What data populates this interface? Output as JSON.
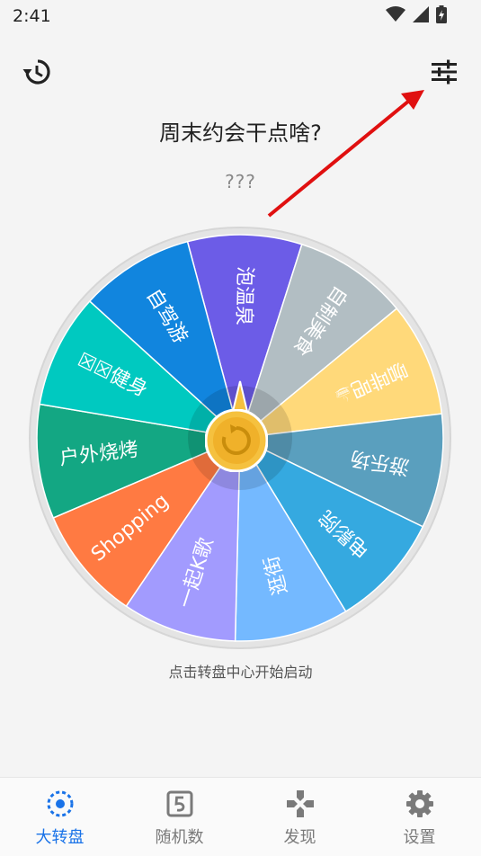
{
  "status_bar": {
    "time": "2:41",
    "icons": [
      "wifi-icon",
      "signal-icon",
      "battery-charging-icon"
    ]
  },
  "toolbar": {
    "history_icon": "history-icon",
    "settings_icon": "tune-sliders-icon"
  },
  "wheel": {
    "title": "周末约会干点啥?",
    "result": "???",
    "hint": "点击转盘中心开始启动",
    "segments": [
      {
        "label": "泡温泉",
        "color": "#6c5ce7"
      },
      {
        "label": "自制美食",
        "color": "#b2bec3"
      },
      {
        "label": "咖啡吧☕",
        "color": "#ffd97a"
      },
      {
        "label": "游乐场",
        "color": "#5a9fbe"
      },
      {
        "label": "电影院",
        "color": "#35a9e0"
      },
      {
        "label": "逛街",
        "color": "#74b9ff"
      },
      {
        "label": "一起K歌",
        "color": "#a29bfe"
      },
      {
        "label": "Shopping",
        "color": "#ff7a42"
      },
      {
        "label": "户外烧烤",
        "color": "#13a783"
      },
      {
        "label": "☒☒健身",
        "color": "#00c9c0"
      },
      {
        "label": "自驾游",
        "color": "#1185de"
      }
    ],
    "center_icon": "refresh-icon"
  },
  "annotation": {
    "arrow_color": "#e01010"
  },
  "tabs": [
    {
      "label": "大转盘",
      "icon": "wheel-icon",
      "active": true
    },
    {
      "label": "随机数",
      "icon": "dice-number-icon",
      "active": false
    },
    {
      "label": "发现",
      "icon": "gamepad-icon",
      "active": false
    },
    {
      "label": "设置",
      "icon": "gear-icon",
      "active": false
    }
  ],
  "colors": {
    "accent": "#1a73e8",
    "inactive": "#7a7a7a"
  }
}
